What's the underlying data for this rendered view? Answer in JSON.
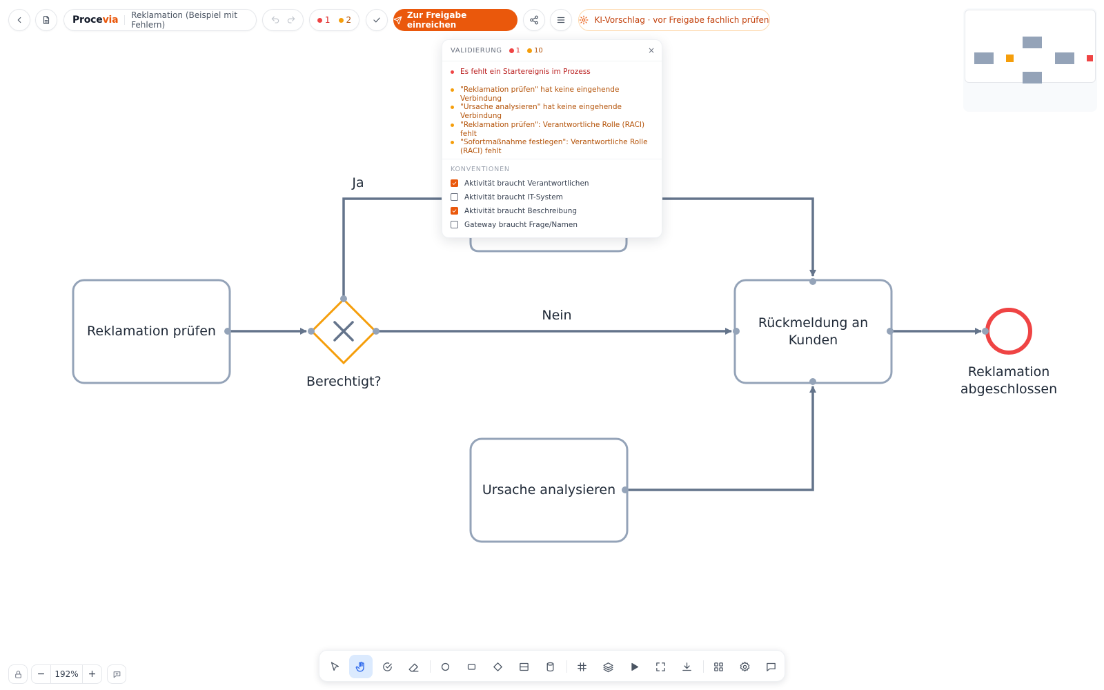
{
  "colors": {
    "accent": "#ea580c",
    "error": "#ef4444",
    "warning": "#f59e0b",
    "node_border": "#94a3b8",
    "flow": "#64748b",
    "gateway": "#f59e0b",
    "end_event": "#ef4444"
  },
  "header": {
    "brand_prefix": "Proce",
    "brand_suffix": "via",
    "document_title": "Reklamation (Beispiel mit Fehlern)",
    "error_count": "1",
    "warning_count": "2",
    "submit_label": "Zur Freigabe einreichen",
    "ai_suggestion_label": "KI-Vorschlag · vor Freigabe fachlich prüfen",
    "icons": [
      "chevron-left-icon",
      "document-icon",
      "undo-icon",
      "redo-icon",
      "check-icon",
      "send-icon",
      "share-icon",
      "menu-icon",
      "sparkle-icon"
    ]
  },
  "validation": {
    "title": "VALIDIERUNG",
    "error_count": "1",
    "warning_count": "10",
    "close_label": "×",
    "issues": [
      {
        "severity": "error",
        "text": "Es fehlt ein Startereignis im Prozess"
      },
      {
        "severity": "warning",
        "text": "\"Reklamation prüfen\" hat keine eingehende Verbindung"
      },
      {
        "severity": "warning",
        "text": "\"Ursache analysieren\" hat keine eingehende Verbindung"
      },
      {
        "severity": "warning",
        "text": "\"Reklamation prüfen\": Verantwortliche Rolle (RACI) fehlt"
      },
      {
        "severity": "warning",
        "text": "\"Sofortmaßnahme festlegen\": Verantwortliche Rolle (RACI) fehlt"
      }
    ],
    "conventions_title": "KONVENTIONEN",
    "conventions": [
      {
        "label": "Aktivität braucht Verantwortlichen",
        "checked": true
      },
      {
        "label": "Aktivität braucht IT-System",
        "checked": false
      },
      {
        "label": "Aktivität braucht Beschreibung",
        "checked": true
      },
      {
        "label": "Gateway braucht Frage/Namen",
        "checked": false
      }
    ]
  },
  "diagram": {
    "tasks": {
      "reklamation": "Reklamation prüfen",
      "rueckmeldung": "Rückmeldung an Kunden",
      "ursache": "Ursache analysieren"
    },
    "gateway_label": "Berechtigt?",
    "end_event_label": "Reklamation abgeschlossen",
    "flow_labels": {
      "yes": "Ja",
      "no": "Nein"
    }
  },
  "zoom": {
    "value": "192%",
    "minus": "−",
    "plus": "+"
  },
  "toolbar": {
    "tools": [
      "select-tool-icon",
      "hand-tool-icon",
      "lasso-tool-icon",
      "eraser-tool-icon",
      "event-shape-icon",
      "task-shape-icon",
      "gateway-shape-icon",
      "lane-shape-icon",
      "datastore-shape-icon",
      "grid-icon",
      "layers-icon",
      "play-icon",
      "fullscreen-icon",
      "download-icon",
      "apps-icon",
      "settings-icon",
      "comment-icon"
    ],
    "active_tool": "hand-tool-icon"
  }
}
